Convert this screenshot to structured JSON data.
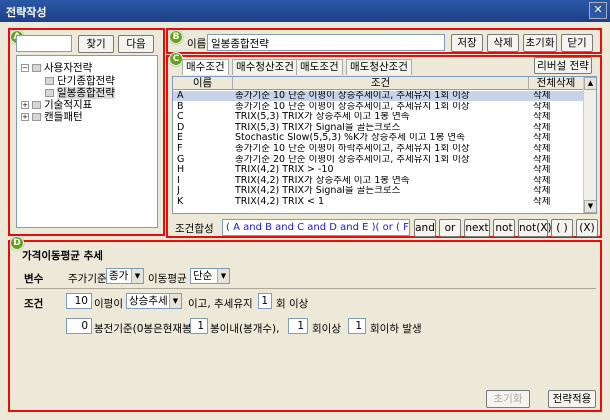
{
  "window": {
    "title": "전략작성",
    "close_glyph": "✕"
  },
  "badges": {
    "a": "A",
    "b": "B",
    "c": "C",
    "d": "D"
  },
  "search": {
    "value": "",
    "find_label": "찾기",
    "next_label": "다음"
  },
  "tree": {
    "items": [
      {
        "label": "사용자전략",
        "toggle": "−",
        "level": 0
      },
      {
        "label": "단기종합전략",
        "toggle": "",
        "level": 1
      },
      {
        "label": "일봉종합전략",
        "toggle": "",
        "level": 1
      },
      {
        "label": "기술적지표",
        "toggle": "+",
        "level": 0
      },
      {
        "label": "캔들패턴",
        "toggle": "+",
        "level": 0
      }
    ]
  },
  "strategy": {
    "name_label": "이름",
    "name_value": "일봉종합전략",
    "save_label": "저장",
    "delete_label": "삭제",
    "reset_label": "초기화",
    "close_label": "닫기"
  },
  "tabs": {
    "items": [
      "매수조건",
      "매수청산조건",
      "매도조건",
      "매도청산조건"
    ],
    "reverse_label": "리버설 전략"
  },
  "grid": {
    "headers": [
      "이름",
      "조건",
      "전체삭제"
    ],
    "rows": [
      {
        "name": "A",
        "cond": "종가기준 10 단순 이평이 상승추세이고, 추세유지 1회 이상",
        "action": "삭제"
      },
      {
        "name": "B",
        "cond": "종가기준 10 단순 이평이 상승추세이고, 추세유지 1회 이상",
        "action": "삭제"
      },
      {
        "name": "C",
        "cond": "TRIX(5,3) TRIX가 상승추세 이고 1봉 연속",
        "action": "삭제"
      },
      {
        "name": "D",
        "cond": "TRIX(5,3) TRIX가 Signal을 골든크로스",
        "action": "삭제"
      },
      {
        "name": "E",
        "cond": "Stochastic Slow(5,5,3) %K가 상승추세 이고 1봉 연속",
        "action": "삭제"
      },
      {
        "name": "F",
        "cond": "종가기준 10 단순 이평이 하락추세이고, 추세유지 1회 이상",
        "action": "삭제"
      },
      {
        "name": "G",
        "cond": "종가기준 20 단순 이평이 상승추세이고, 추세유지 1회 이상",
        "action": "삭제"
      },
      {
        "name": "H",
        "cond": "TRIX(4,2) TRIX > -10",
        "action": "삭제"
      },
      {
        "name": "I",
        "cond": "TRIX(4,2) TRIX가 상승추세 이고 1봉 연속",
        "action": "삭제"
      },
      {
        "name": "J",
        "cond": "TRIX(4,2) TRIX가 Signal을 골든크로스",
        "action": "삭제"
      },
      {
        "name": "K",
        "cond": "TRIX(4,2) TRIX < 1",
        "action": "삭제"
      }
    ]
  },
  "combine": {
    "label": "조건합성",
    "expression": "( A and B and C and D and E )( or ( F and",
    "buttons": [
      "and",
      "or",
      "next",
      "not",
      "not(X)",
      "( )",
      "(X)"
    ]
  },
  "panel_d": {
    "title": "가격이동평균 추세",
    "variable_label": "변수",
    "price_base_label": "주가기준",
    "price_base_value": "종가",
    "ma_label": "이동평균",
    "ma_value": "단순",
    "condition_label": "조건",
    "period_value": "10",
    "ma_is_label": "이평이",
    "trend_value": "상승추세",
    "trend_keep_label": "이고, 추세유지",
    "keep_count": "1",
    "times_above_label": "회 이상",
    "bars_value": "0",
    "bars_basis_label": "봉전기준(0봉은현재봉)",
    "within_value": "1",
    "within_label": "봉이내(봉개수),",
    "min_value": "1",
    "min_label": "회이상",
    "max_value": "1",
    "max_label": "회이하 발생",
    "reset_label": "초기화",
    "apply_label": "전략적용"
  },
  "colors": {
    "highlight": "#e01010",
    "badge": "#62a51a",
    "titlebar": "#2b58a6"
  }
}
